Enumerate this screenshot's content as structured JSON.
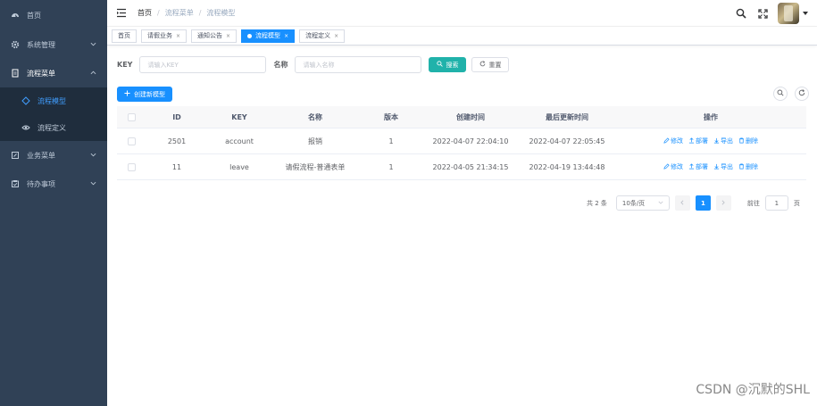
{
  "sidebar": {
    "items": [
      {
        "label": "首页",
        "icon": "dashboard-icon"
      },
      {
        "label": "系统管理",
        "icon": "gear-icon"
      },
      {
        "label": "流程菜单",
        "icon": "document-icon"
      },
      {
        "label": "业务菜单",
        "icon": "edit-icon"
      },
      {
        "label": "待办事项",
        "icon": "task-icon"
      }
    ],
    "submenu": [
      {
        "label": "流程模型",
        "icon": "flow-icon"
      },
      {
        "label": "流程定义",
        "icon": "eye-icon"
      }
    ]
  },
  "header": {
    "breadcrumb": [
      "首页",
      "流程菜单",
      "流程模型"
    ],
    "separator": "/"
  },
  "tags": [
    {
      "label": "首页",
      "closable": false
    },
    {
      "label": "请假业务",
      "closable": true
    },
    {
      "label": "通知公告",
      "closable": true
    },
    {
      "label": "流程模型",
      "closable": true
    },
    {
      "label": "流程定义",
      "closable": true
    }
  ],
  "tag_close": "×",
  "form": {
    "key_label": "KEY",
    "key_placeholder": "请输入KEY",
    "name_label": "名称",
    "name_placeholder": "请输入名称",
    "search_label": "搜索",
    "reset_label": "重置"
  },
  "toolbar": {
    "create_label": "创建新模型"
  },
  "table": {
    "columns": [
      "ID",
      "KEY",
      "名称",
      "版本",
      "创建时间",
      "最后更新时间",
      "操作"
    ],
    "rows": [
      {
        "id": "2501",
        "key": "account",
        "name": "报销",
        "version": "1",
        "created": "2022-04-07 22:04:10",
        "updated": "2022-04-07 22:05:45"
      },
      {
        "id": "11",
        "key": "leave",
        "name": "请假流程-普通表单",
        "version": "1",
        "created": "2022-04-05 21:34:15",
        "updated": "2022-04-19 13:44:48"
      }
    ],
    "actions": [
      "修改",
      "部署",
      "导出",
      "删除"
    ]
  },
  "pagination": {
    "total_text": "共 2 条",
    "page_size": "10条/页",
    "current_page": "1",
    "goto_label": "前往",
    "goto_value": "1",
    "page_unit": "页"
  },
  "watermark": "CSDN @沉默的SHL",
  "colors": {
    "sidebar_bg": "#304156",
    "submenu_bg": "#1f2d3d",
    "primary": "#1890ff",
    "search_btn": "#20b2aa"
  }
}
